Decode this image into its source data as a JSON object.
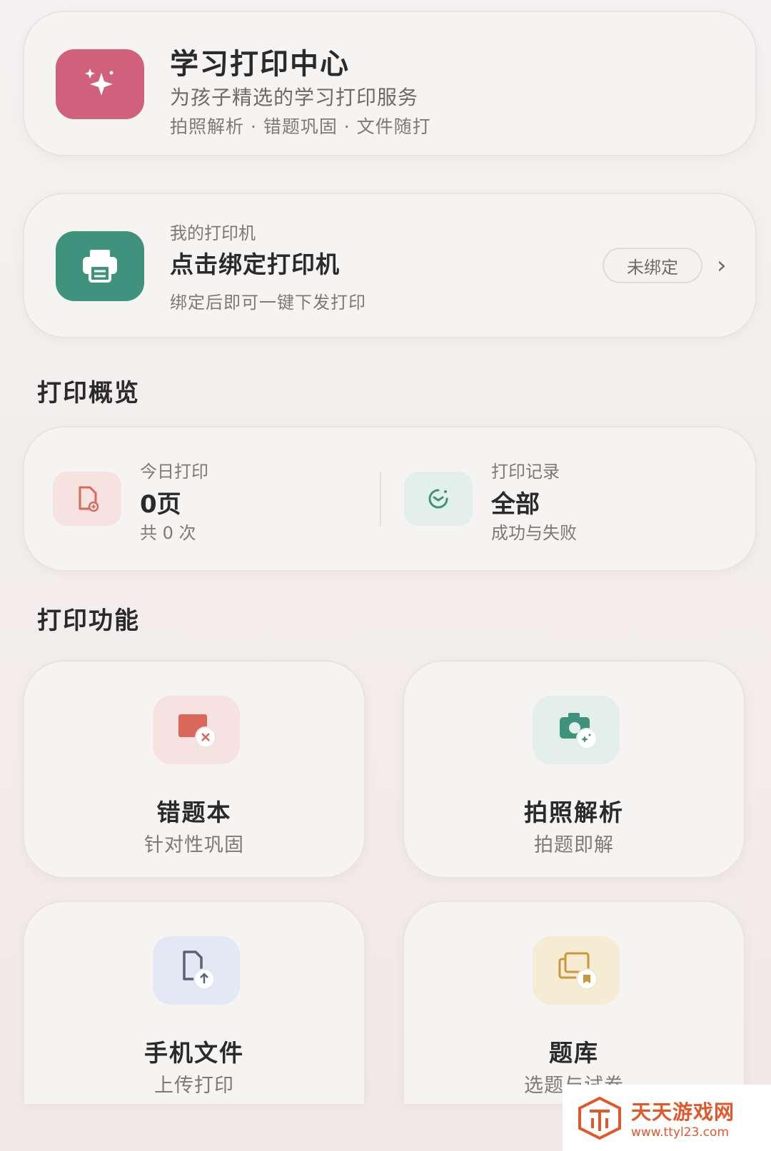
{
  "hero": {
    "title": "学习打印中心",
    "subtitle": "为孩子精选的学习打印服务",
    "tags": "拍照解析 · 错题巩固 · 文件随打",
    "icon": "sparkle-icon",
    "icon_bg": "#d1607a"
  },
  "printer": {
    "label": "我的打印机",
    "title": "点击绑定打印机",
    "subtitle": "绑定后即可一键下发打印",
    "status_badge": "未绑定",
    "icon": "printer-icon",
    "icon_bg": "#3f937c"
  },
  "overview": {
    "section_title": "打印概览",
    "today": {
      "label": "今日打印",
      "value": "0页",
      "sub": "共 0 次",
      "icon": "document-add-icon"
    },
    "records": {
      "label": "打印记录",
      "value": "全部",
      "sub": "成功与失败",
      "icon": "history-clock-icon"
    }
  },
  "features": {
    "section_title": "打印功能",
    "items": [
      {
        "title": "错题本",
        "sub": "针对性巩固",
        "icon": "wrong-answer-icon",
        "bg": "#f6e3e1"
      },
      {
        "title": "拍照解析",
        "sub": "拍题即解",
        "icon": "camera-sparkle-icon",
        "bg": "#e2efea"
      },
      {
        "title": "手机文件",
        "sub": "上传打印",
        "icon": "file-upload-icon",
        "bg": "#e4e8f5"
      },
      {
        "title": "题库",
        "sub": "选题与试卷",
        "icon": "question-bank-icon",
        "bg": "#f6ecd4"
      }
    ]
  },
  "watermark": {
    "brand": "天天游戏网",
    "url": "www.ttyl23.com"
  }
}
